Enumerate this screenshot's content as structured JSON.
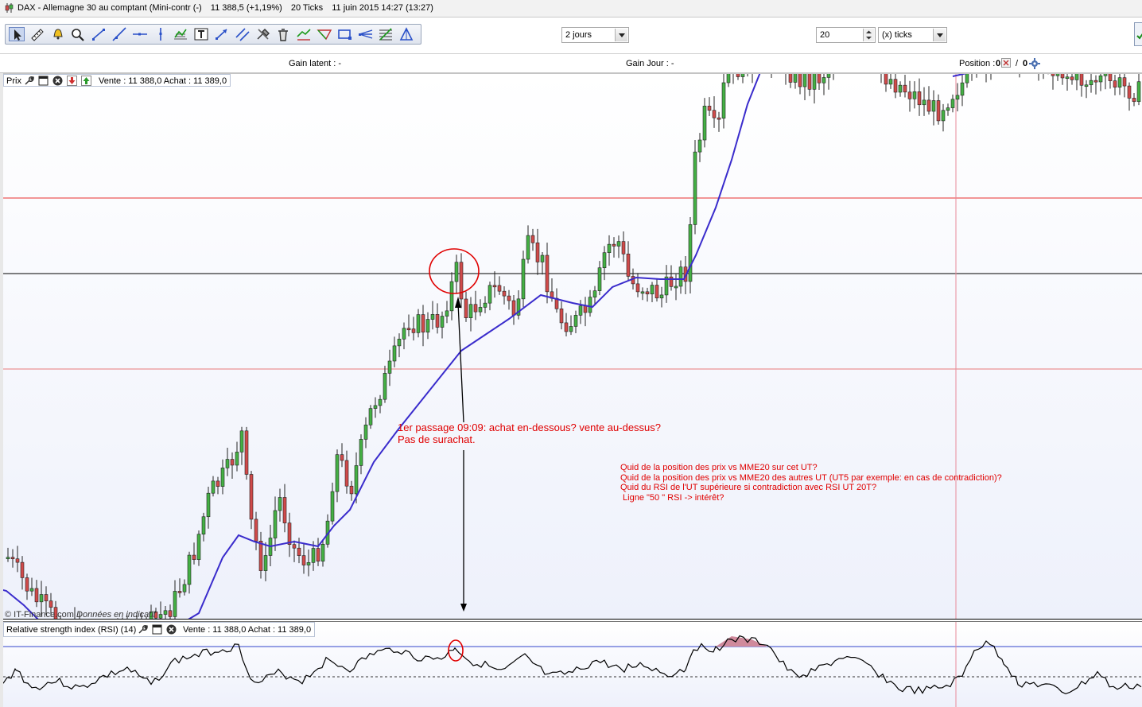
{
  "window": {
    "title": "DAX - Allemagne 30 au comptant (Mini-contr (-)",
    "quote": "11 388,5 (+1,19%)",
    "ticks_info": "20 Ticks",
    "datetime": "11 juin 2015 14:27 (13:27)"
  },
  "toolbar": {
    "tools": [
      "pointer-icon",
      "ruler-icon",
      "alert-bell-icon",
      "zoom-icon",
      "line-icon",
      "ray-icon",
      "horizontal-line-icon",
      "vertical-line-icon",
      "indicator-icon",
      "text-icon",
      "arrow-line-icon",
      "parallel-lines-icon",
      "tools-icon",
      "trash-icon",
      "channel-icon",
      "triangle-tool-icon",
      "rectangle-icon",
      "fibonacci-fan-icon",
      "fibonacci-retracement-icon",
      "pitchfork-icon"
    ],
    "period_value": "2 jours",
    "ticks_value": "20",
    "ticks_unit": "(x) ticks"
  },
  "status": {
    "gain_latent": "Gain latent : -",
    "gain_jour": "Gain Jour : -",
    "position_label": "Position :",
    "position_value": "0",
    "position_sep": "/",
    "position_value2": "0"
  },
  "price_panel": {
    "legend_name": "Prix",
    "legend_quote": "Vente : 11 388,0 Achat : 11 389,0",
    "copyright": "© IT-Finance.com",
    "disclaimer": "Données en indicatif"
  },
  "rsi_panel": {
    "legend_name": "Relative strength index (RSI) (14)",
    "legend_quote": "Vente : 11 388,0 Achat : 11 389,0"
  },
  "annotations": {
    "main_line1": "1er passage 09:09: achat en-dessous? vente au-dessus?",
    "main_line2": "Pas de surachat.",
    "questions": [
      "Quid de la position des prix vs MME20 sur cet UT?",
      "Quid de la position des prix vs MME20 des autres UT (UT5 par exemple: en cas de contradiction)?",
      "Quid du RSI de l'UT supérieure si contradiction avec RSI UT 20T?",
      " Ligne \"50 \" RSI -> intérêt?"
    ]
  },
  "colors": {
    "bull_candle": "#44b044",
    "bear_candle": "#d04a4a",
    "ema_line": "#3a2ccc",
    "annotation": "#e00000",
    "horizontal_line": "#000000",
    "red_level_line": "#e83030",
    "rsi_line": "#000000",
    "rsi_band": "#3344cc",
    "overbought_fill": "#d08a9c"
  }
}
